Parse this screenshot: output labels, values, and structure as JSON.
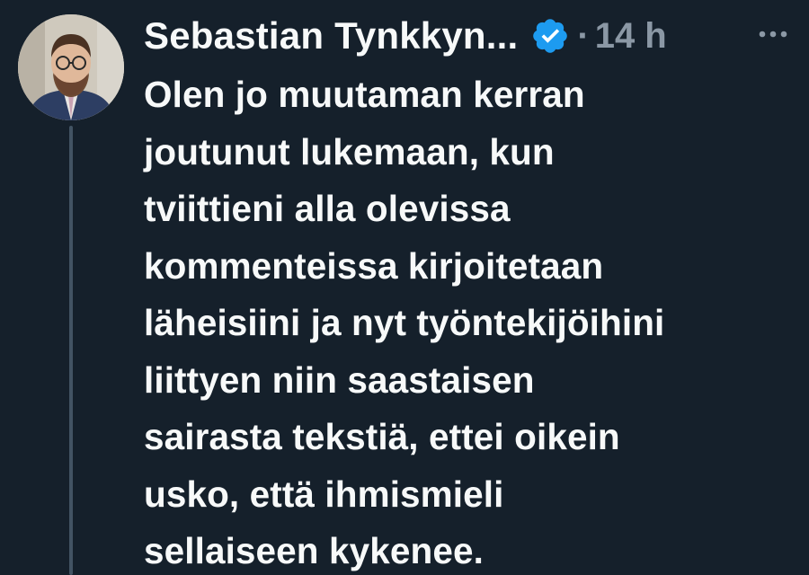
{
  "colors": {
    "background": "#15202b",
    "text_primary": "#f7f9f9",
    "text_secondary": "#8b98a5",
    "verified_badge": "#1d9bf0",
    "thread_line": "#425363"
  },
  "tweet": {
    "author": {
      "display_name": "Sebastian Tynkkyn...",
      "verified": true,
      "verified_icon": "verified-badge-icon",
      "avatar_icon": "profile-photo"
    },
    "separator": "·",
    "timestamp": "14 h",
    "more_icon": "more-horizontal-icon",
    "text_lines": [
      "Olen jo muutaman kerran",
      "joutunut lukemaan, kun",
      "tviittieni alla olevissa",
      "kommenteissa kirjoitetaan",
      "läheisiini ja nyt työntekijöihini",
      "liittyen niin saastaisen",
      "sairasta tekstiä, ettei oikein",
      "usko, että ihmismieli",
      "sellaiseen kykenee."
    ]
  }
}
